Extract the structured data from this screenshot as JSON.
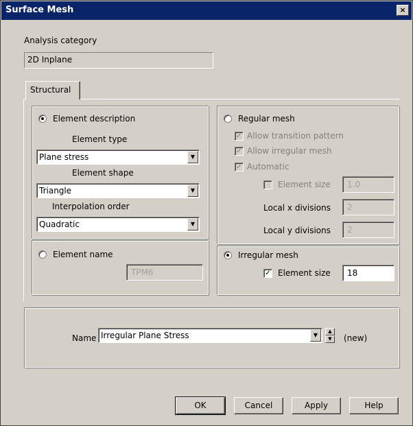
{
  "window": {
    "title": "Surface Mesh",
    "close_glyph": "×"
  },
  "analysis": {
    "label": "Analysis category",
    "value": "2D Inplane"
  },
  "tabs": [
    {
      "label": "Structural"
    }
  ],
  "left": {
    "element_description_label": "Element description",
    "element_description_selected": true,
    "element_type_label": "Element type",
    "element_type_value": "Plane stress",
    "element_shape_label": "Element shape",
    "element_shape_value": "Triangle",
    "interpolation_label": "Interpolation order",
    "interpolation_value": "Quadratic",
    "element_name_label": "Element name",
    "element_name_selected": false,
    "element_name_value": "TPM6"
  },
  "right": {
    "regular_mesh_label": "Regular mesh",
    "regular_mesh_selected": false,
    "allow_transition_label": "Allow transition pattern",
    "allow_irregular_label": "Allow irregular mesh",
    "automatic_label": "Automatic",
    "reg_element_size_label": "Element size",
    "reg_element_size_value": "1.0",
    "local_x_label": "Local x divisions",
    "local_x_value": "2",
    "local_y_label": "Local y divisions",
    "local_y_value": "2",
    "irregular_mesh_label": "Irregular mesh",
    "irregular_mesh_selected": true,
    "irr_element_size_label": "Element size",
    "irr_element_size_checked": true,
    "irr_element_size_value": "18"
  },
  "name_row": {
    "label": "Name",
    "value": "Irregular Plane Stress",
    "status": "(new)"
  },
  "buttons": {
    "ok": "OK",
    "cancel": "Cancel",
    "apply": "Apply",
    "help": "Help"
  },
  "icons": {
    "check": "✓",
    "dropdown": "▼",
    "spin_up": "▲",
    "spin_down": "▼"
  },
  "colors": {
    "title_bar": "#0a246a",
    "face": "#d4d0c8"
  }
}
